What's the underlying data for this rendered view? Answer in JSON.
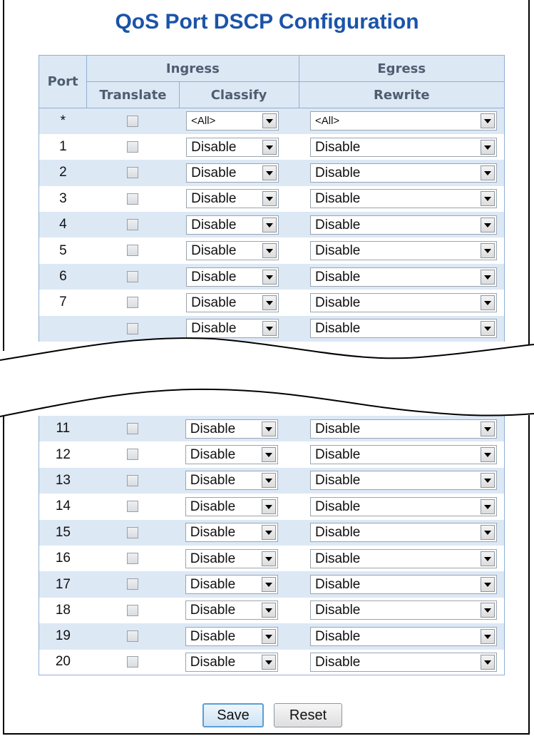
{
  "title": "QoS Port DSCP Configuration",
  "header": {
    "port": "Port",
    "ingress": "Ingress",
    "egress": "Egress",
    "translate": "Translate",
    "classify": "Classify",
    "rewrite": "Rewrite"
  },
  "top_rows": [
    {
      "port": "*",
      "translate": false,
      "classify": "<All>",
      "rewrite": "<All>"
    },
    {
      "port": "1",
      "translate": false,
      "classify": "Disable",
      "rewrite": "Disable"
    },
    {
      "port": "2",
      "translate": false,
      "classify": "Disable",
      "rewrite": "Disable"
    },
    {
      "port": "3",
      "translate": false,
      "classify": "Disable",
      "rewrite": "Disable"
    },
    {
      "port": "4",
      "translate": false,
      "classify": "Disable",
      "rewrite": "Disable"
    },
    {
      "port": "5",
      "translate": false,
      "classify": "Disable",
      "rewrite": "Disable"
    },
    {
      "port": "6",
      "translate": false,
      "classify": "Disable",
      "rewrite": "Disable"
    },
    {
      "port": "7",
      "translate": false,
      "classify": "Disable",
      "rewrite": "Disable"
    },
    {
      "port": "",
      "translate": false,
      "classify": "Disable",
      "rewrite": "Disable"
    }
  ],
  "bottom_rows": [
    {
      "port": "11",
      "translate": false,
      "classify": "Disable",
      "rewrite": "Disable"
    },
    {
      "port": "12",
      "translate": false,
      "classify": "Disable",
      "rewrite": "Disable"
    },
    {
      "port": "13",
      "translate": false,
      "classify": "Disable",
      "rewrite": "Disable"
    },
    {
      "port": "14",
      "translate": false,
      "classify": "Disable",
      "rewrite": "Disable"
    },
    {
      "port": "15",
      "translate": false,
      "classify": "Disable",
      "rewrite": "Disable"
    },
    {
      "port": "16",
      "translate": false,
      "classify": "Disable",
      "rewrite": "Disable"
    },
    {
      "port": "17",
      "translate": false,
      "classify": "Disable",
      "rewrite": "Disable"
    },
    {
      "port": "18",
      "translate": false,
      "classify": "Disable",
      "rewrite": "Disable"
    },
    {
      "port": "19",
      "translate": false,
      "classify": "Disable",
      "rewrite": "Disable"
    },
    {
      "port": "20",
      "translate": false,
      "classify": "Disable",
      "rewrite": "Disable"
    }
  ],
  "buttons": {
    "save": "Save",
    "reset": "Reset"
  },
  "colors": {
    "title": "#1a54a8",
    "header_bg": "#dde8f5",
    "border": "#8fb0d3"
  }
}
